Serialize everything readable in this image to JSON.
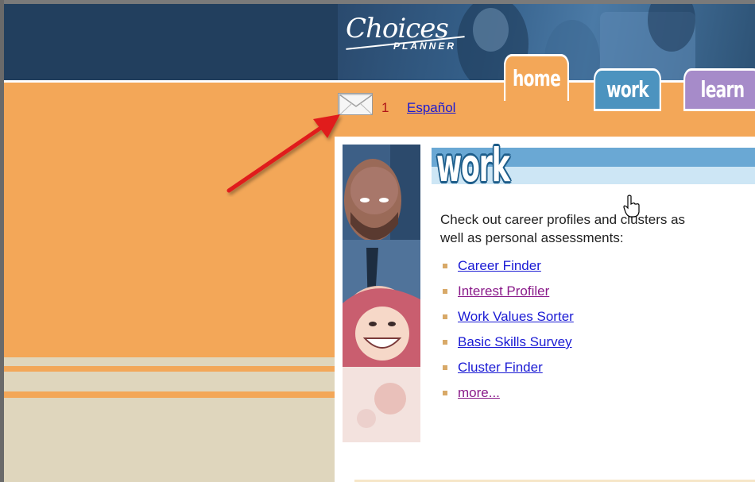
{
  "header": {
    "logo_script": "Choices",
    "logo_sub": "PLANNER"
  },
  "tabs": [
    {
      "label": "home",
      "color": "#f3a758",
      "active": true
    },
    {
      "label": "work",
      "color": "#4c93bf",
      "active": false
    },
    {
      "label": "learn",
      "color": "#a68bc9",
      "active": false
    }
  ],
  "messages": {
    "icon": "envelope-icon",
    "count": "1",
    "language_link": "Español"
  },
  "section": {
    "title": "work",
    "description_line1": "Check out career profiles and clusters as",
    "description_line2": "well as personal assessments:",
    "links": [
      {
        "label": "Career Finder",
        "visited": false
      },
      {
        "label": "Interest Profiler",
        "visited": true
      },
      {
        "label": "Work Values Sorter",
        "visited": false
      },
      {
        "label": "Basic Skills Survey",
        "visited": false
      },
      {
        "label": "Cluster Finder",
        "visited": false
      },
      {
        "label": "more...",
        "visited": true
      }
    ]
  },
  "colors": {
    "header_bg": "#223f5e",
    "orange": "#f3a758",
    "beige": "#dfd6bd",
    "link": "#1a1ad4",
    "visited_link": "#8a1a8a",
    "annotation_arrow": "#e01b1b"
  }
}
